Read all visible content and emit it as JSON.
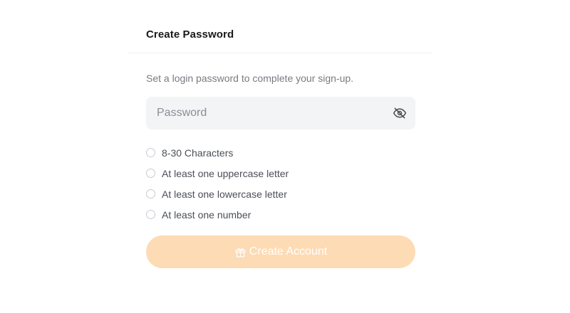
{
  "header": {
    "title": "Create Password"
  },
  "form": {
    "subtitle": "Set a login password to complete your sign-up.",
    "password": {
      "placeholder": "Password",
      "value": "",
      "toggle_icon": "eye-off-icon"
    },
    "rules": [
      {
        "label": "8-30 Characters",
        "met": false
      },
      {
        "label": "At least one uppercase letter",
        "met": false
      },
      {
        "label": "At least one lowercase letter",
        "met": false
      },
      {
        "label": "At least one number",
        "met": false
      }
    ],
    "submit": {
      "label": "Create Account",
      "icon": "gift-icon",
      "enabled": false,
      "color": "#fddbb4"
    }
  }
}
